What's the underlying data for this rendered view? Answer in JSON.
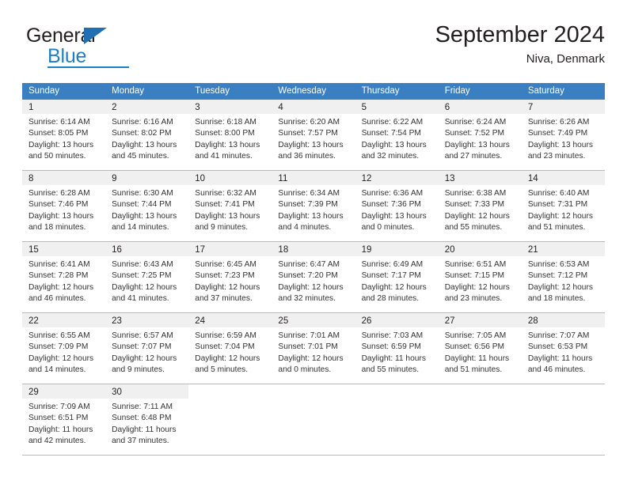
{
  "brand": {
    "name_part1": "General",
    "name_part2": "Blue",
    "triangle_color": "#1f6fb2",
    "blue_color": "#1f7fc4"
  },
  "header": {
    "title": "September 2024",
    "subtitle": "Niva, Denmark",
    "header_bg": "#3a7fc1",
    "daynum_bg": "#f0f0f0"
  },
  "weekdays": [
    "Sunday",
    "Monday",
    "Tuesday",
    "Wednesday",
    "Thursday",
    "Friday",
    "Saturday"
  ],
  "weeks": [
    {
      "days": [
        {
          "num": "1",
          "sunrise": "Sunrise: 6:14 AM",
          "sunset": "Sunset: 8:05 PM",
          "daylight1": "Daylight: 13 hours",
          "daylight2": "and 50 minutes."
        },
        {
          "num": "2",
          "sunrise": "Sunrise: 6:16 AM",
          "sunset": "Sunset: 8:02 PM",
          "daylight1": "Daylight: 13 hours",
          "daylight2": "and 45 minutes."
        },
        {
          "num": "3",
          "sunrise": "Sunrise: 6:18 AM",
          "sunset": "Sunset: 8:00 PM",
          "daylight1": "Daylight: 13 hours",
          "daylight2": "and 41 minutes."
        },
        {
          "num": "4",
          "sunrise": "Sunrise: 6:20 AM",
          "sunset": "Sunset: 7:57 PM",
          "daylight1": "Daylight: 13 hours",
          "daylight2": "and 36 minutes."
        },
        {
          "num": "5",
          "sunrise": "Sunrise: 6:22 AM",
          "sunset": "Sunset: 7:54 PM",
          "daylight1": "Daylight: 13 hours",
          "daylight2": "and 32 minutes."
        },
        {
          "num": "6",
          "sunrise": "Sunrise: 6:24 AM",
          "sunset": "Sunset: 7:52 PM",
          "daylight1": "Daylight: 13 hours",
          "daylight2": "and 27 minutes."
        },
        {
          "num": "7",
          "sunrise": "Sunrise: 6:26 AM",
          "sunset": "Sunset: 7:49 PM",
          "daylight1": "Daylight: 13 hours",
          "daylight2": "and 23 minutes."
        }
      ]
    },
    {
      "days": [
        {
          "num": "8",
          "sunrise": "Sunrise: 6:28 AM",
          "sunset": "Sunset: 7:46 PM",
          "daylight1": "Daylight: 13 hours",
          "daylight2": "and 18 minutes."
        },
        {
          "num": "9",
          "sunrise": "Sunrise: 6:30 AM",
          "sunset": "Sunset: 7:44 PM",
          "daylight1": "Daylight: 13 hours",
          "daylight2": "and 14 minutes."
        },
        {
          "num": "10",
          "sunrise": "Sunrise: 6:32 AM",
          "sunset": "Sunset: 7:41 PM",
          "daylight1": "Daylight: 13 hours",
          "daylight2": "and 9 minutes."
        },
        {
          "num": "11",
          "sunrise": "Sunrise: 6:34 AM",
          "sunset": "Sunset: 7:39 PM",
          "daylight1": "Daylight: 13 hours",
          "daylight2": "and 4 minutes."
        },
        {
          "num": "12",
          "sunrise": "Sunrise: 6:36 AM",
          "sunset": "Sunset: 7:36 PM",
          "daylight1": "Daylight: 13 hours",
          "daylight2": "and 0 minutes."
        },
        {
          "num": "13",
          "sunrise": "Sunrise: 6:38 AM",
          "sunset": "Sunset: 7:33 PM",
          "daylight1": "Daylight: 12 hours",
          "daylight2": "and 55 minutes."
        },
        {
          "num": "14",
          "sunrise": "Sunrise: 6:40 AM",
          "sunset": "Sunset: 7:31 PM",
          "daylight1": "Daylight: 12 hours",
          "daylight2": "and 51 minutes."
        }
      ]
    },
    {
      "days": [
        {
          "num": "15",
          "sunrise": "Sunrise: 6:41 AM",
          "sunset": "Sunset: 7:28 PM",
          "daylight1": "Daylight: 12 hours",
          "daylight2": "and 46 minutes."
        },
        {
          "num": "16",
          "sunrise": "Sunrise: 6:43 AM",
          "sunset": "Sunset: 7:25 PM",
          "daylight1": "Daylight: 12 hours",
          "daylight2": "and 41 minutes."
        },
        {
          "num": "17",
          "sunrise": "Sunrise: 6:45 AM",
          "sunset": "Sunset: 7:23 PM",
          "daylight1": "Daylight: 12 hours",
          "daylight2": "and 37 minutes."
        },
        {
          "num": "18",
          "sunrise": "Sunrise: 6:47 AM",
          "sunset": "Sunset: 7:20 PM",
          "daylight1": "Daylight: 12 hours",
          "daylight2": "and 32 minutes."
        },
        {
          "num": "19",
          "sunrise": "Sunrise: 6:49 AM",
          "sunset": "Sunset: 7:17 PM",
          "daylight1": "Daylight: 12 hours",
          "daylight2": "and 28 minutes."
        },
        {
          "num": "20",
          "sunrise": "Sunrise: 6:51 AM",
          "sunset": "Sunset: 7:15 PM",
          "daylight1": "Daylight: 12 hours",
          "daylight2": "and 23 minutes."
        },
        {
          "num": "21",
          "sunrise": "Sunrise: 6:53 AM",
          "sunset": "Sunset: 7:12 PM",
          "daylight1": "Daylight: 12 hours",
          "daylight2": "and 18 minutes."
        }
      ]
    },
    {
      "days": [
        {
          "num": "22",
          "sunrise": "Sunrise: 6:55 AM",
          "sunset": "Sunset: 7:09 PM",
          "daylight1": "Daylight: 12 hours",
          "daylight2": "and 14 minutes."
        },
        {
          "num": "23",
          "sunrise": "Sunrise: 6:57 AM",
          "sunset": "Sunset: 7:07 PM",
          "daylight1": "Daylight: 12 hours",
          "daylight2": "and 9 minutes."
        },
        {
          "num": "24",
          "sunrise": "Sunrise: 6:59 AM",
          "sunset": "Sunset: 7:04 PM",
          "daylight1": "Daylight: 12 hours",
          "daylight2": "and 5 minutes."
        },
        {
          "num": "25",
          "sunrise": "Sunrise: 7:01 AM",
          "sunset": "Sunset: 7:01 PM",
          "daylight1": "Daylight: 12 hours",
          "daylight2": "and 0 minutes."
        },
        {
          "num": "26",
          "sunrise": "Sunrise: 7:03 AM",
          "sunset": "Sunset: 6:59 PM",
          "daylight1": "Daylight: 11 hours",
          "daylight2": "and 55 minutes."
        },
        {
          "num": "27",
          "sunrise": "Sunrise: 7:05 AM",
          "sunset": "Sunset: 6:56 PM",
          "daylight1": "Daylight: 11 hours",
          "daylight2": "and 51 minutes."
        },
        {
          "num": "28",
          "sunrise": "Sunrise: 7:07 AM",
          "sunset": "Sunset: 6:53 PM",
          "daylight1": "Daylight: 11 hours",
          "daylight2": "and 46 minutes."
        }
      ]
    },
    {
      "days": [
        {
          "num": "29",
          "sunrise": "Sunrise: 7:09 AM",
          "sunset": "Sunset: 6:51 PM",
          "daylight1": "Daylight: 11 hours",
          "daylight2": "and 42 minutes."
        },
        {
          "num": "30",
          "sunrise": "Sunrise: 7:11 AM",
          "sunset": "Sunset: 6:48 PM",
          "daylight1": "Daylight: 11 hours",
          "daylight2": "and 37 minutes."
        },
        {
          "num": "",
          "sunrise": "",
          "sunset": "",
          "daylight1": "",
          "daylight2": ""
        },
        {
          "num": "",
          "sunrise": "",
          "sunset": "",
          "daylight1": "",
          "daylight2": ""
        },
        {
          "num": "",
          "sunrise": "",
          "sunset": "",
          "daylight1": "",
          "daylight2": ""
        },
        {
          "num": "",
          "sunrise": "",
          "sunset": "",
          "daylight1": "",
          "daylight2": ""
        },
        {
          "num": "",
          "sunrise": "",
          "sunset": "",
          "daylight1": "",
          "daylight2": ""
        }
      ]
    }
  ]
}
